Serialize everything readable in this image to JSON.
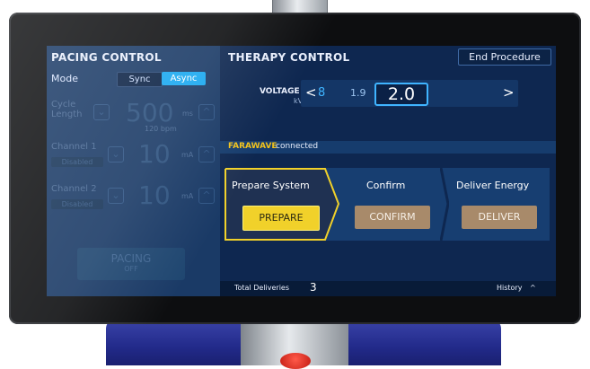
{
  "pacing": {
    "title": "PACING CONTROL",
    "mode_label": "Mode",
    "sync_label": "Sync",
    "async_label": "Async",
    "cycle_length_label_1": "Cycle",
    "cycle_length_label_2": "Length",
    "cycle_length_value": "500",
    "cycle_length_unit": "ms",
    "cycle_length_sub": "120 bpm",
    "channel1_label": "Channel 1",
    "channel1_status": "Disabled",
    "channel1_value": "10",
    "channel1_unit": "mA",
    "channel2_label": "Channel 2",
    "channel2_status": "Disabled",
    "channel2_value": "10",
    "channel2_unit": "mA",
    "pacing_button_line1": "PACING",
    "pacing_button_line2": "OFF",
    "minus": "⌄",
    "plus": "^"
  },
  "therapy": {
    "title": "THERAPY CONTROL",
    "end_procedure_label": "End Procedure",
    "voltage_label": "VOLTAGE",
    "voltage_unit": "kV",
    "voltage_prev_arrow": "<",
    "voltage_next_arrow": ">",
    "voltage_option_1": "8",
    "voltage_option_2": "1.9",
    "voltage_selected": "2.0",
    "connection_brand": "FARAWAVE",
    "connection_status": " connected",
    "steps": [
      {
        "title": "Prepare System",
        "button": "PREPARE"
      },
      {
        "title": "Confirm",
        "button": "CONFIRM"
      },
      {
        "title": "Deliver Energy",
        "button": "DELIVER"
      }
    ],
    "total_deliveries_label": "Total Deliveries",
    "total_deliveries_value": "3",
    "history_label": "History",
    "history_icon": "^"
  },
  "colors": {
    "accent": "#19a8f0",
    "prepare": "#f1d12a",
    "brand_text": "#f1c21b",
    "step_button": "#a88a6a"
  }
}
